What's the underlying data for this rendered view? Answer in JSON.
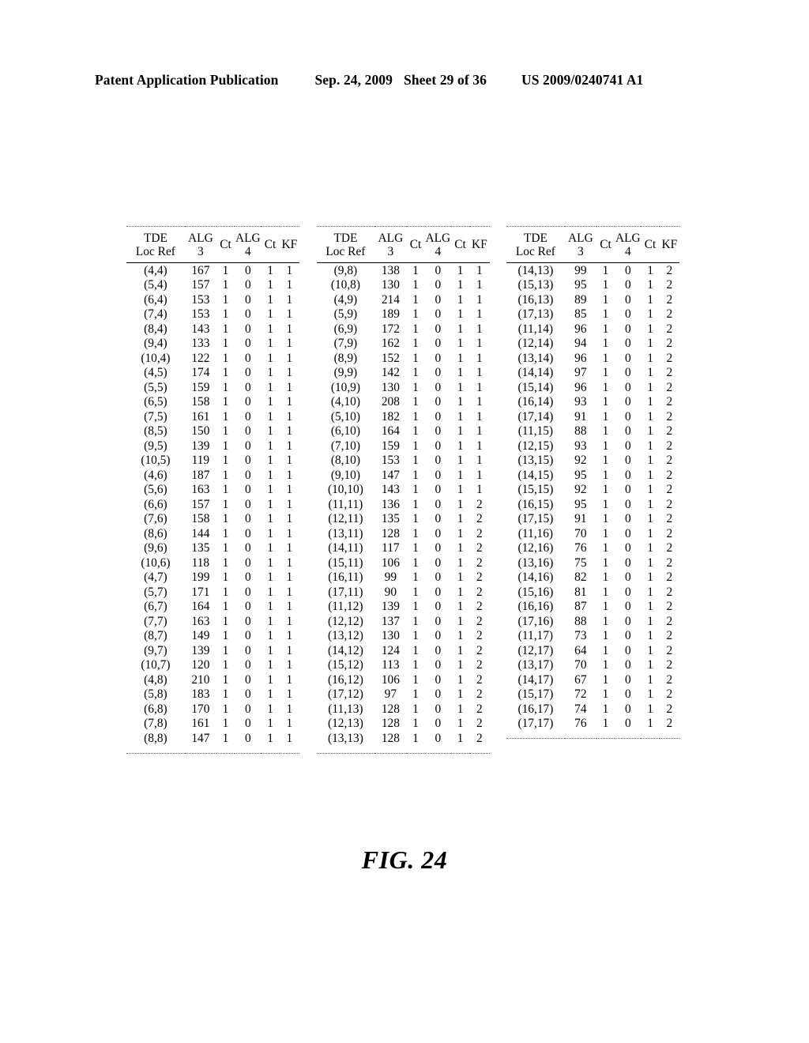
{
  "header": {
    "publication": "Patent Application Publication",
    "date": "Sep. 24, 2009",
    "sheet": "Sheet 29 of 36",
    "patent_number": "US 2009/0240741 A1"
  },
  "figure": {
    "caption": "FIG. 24"
  },
  "table": {
    "columns": [
      {
        "key": "loc",
        "label_line1": "TDE",
        "label_line2": "Loc Ref"
      },
      {
        "key": "alg3",
        "label_line1": "ALG",
        "label_line2": "3"
      },
      {
        "key": "ct1",
        "label_line1": "Ct",
        "label_line2": ""
      },
      {
        "key": "alg4",
        "label_line1": "ALG",
        "label_line2": "4"
      },
      {
        "key": "ct2",
        "label_line1": "Ct",
        "label_line2": ""
      },
      {
        "key": "kf",
        "label_line1": "KF",
        "label_line2": ""
      }
    ],
    "blocks": [
      {
        "id": "block-1",
        "rows": [
          [
            "(4,4)",
            "167",
            "1",
            "0",
            "1",
            "1"
          ],
          [
            "(5,4)",
            "157",
            "1",
            "0",
            "1",
            "1"
          ],
          [
            "(6,4)",
            "153",
            "1",
            "0",
            "1",
            "1"
          ],
          [
            "(7,4)",
            "153",
            "1",
            "0",
            "1",
            "1"
          ],
          [
            "(8,4)",
            "143",
            "1",
            "0",
            "1",
            "1"
          ],
          [
            "(9,4)",
            "133",
            "1",
            "0",
            "1",
            "1"
          ],
          [
            "(10,4)",
            "122",
            "1",
            "0",
            "1",
            "1"
          ],
          [
            "(4,5)",
            "174",
            "1",
            "0",
            "1",
            "1"
          ],
          [
            "(5,5)",
            "159",
            "1",
            "0",
            "1",
            "1"
          ],
          [
            "(6,5)",
            "158",
            "1",
            "0",
            "1",
            "1"
          ],
          [
            "(7,5)",
            "161",
            "1",
            "0",
            "1",
            "1"
          ],
          [
            "(8,5)",
            "150",
            "1",
            "0",
            "1",
            "1"
          ],
          [
            "(9,5)",
            "139",
            "1",
            "0",
            "1",
            "1"
          ],
          [
            "(10,5)",
            "119",
            "1",
            "0",
            "1",
            "1"
          ],
          [
            "(4,6)",
            "187",
            "1",
            "0",
            "1",
            "1"
          ],
          [
            "(5,6)",
            "163",
            "1",
            "0",
            "1",
            "1"
          ],
          [
            "(6,6)",
            "157",
            "1",
            "0",
            "1",
            "1"
          ],
          [
            "(7,6)",
            "158",
            "1",
            "0",
            "1",
            "1"
          ],
          [
            "(8,6)",
            "144",
            "1",
            "0",
            "1",
            "1"
          ],
          [
            "(9,6)",
            "135",
            "1",
            "0",
            "1",
            "1"
          ],
          [
            "(10,6)",
            "118",
            "1",
            "0",
            "1",
            "1"
          ],
          [
            "(4,7)",
            "199",
            "1",
            "0",
            "1",
            "1"
          ],
          [
            "(5,7)",
            "171",
            "1",
            "0",
            "1",
            "1"
          ],
          [
            "(6,7)",
            "164",
            "1",
            "0",
            "1",
            "1"
          ],
          [
            "(7,7)",
            "163",
            "1",
            "0",
            "1",
            "1"
          ],
          [
            "(8,7)",
            "149",
            "1",
            "0",
            "1",
            "1"
          ],
          [
            "(9,7)",
            "139",
            "1",
            "0",
            "1",
            "1"
          ],
          [
            "(10,7)",
            "120",
            "1",
            "0",
            "1",
            "1"
          ],
          [
            "(4,8)",
            "210",
            "1",
            "0",
            "1",
            "1"
          ],
          [
            "(5,8)",
            "183",
            "1",
            "0",
            "1",
            "1"
          ],
          [
            "(6,8)",
            "170",
            "1",
            "0",
            "1",
            "1"
          ],
          [
            "(7,8)",
            "161",
            "1",
            "0",
            "1",
            "1"
          ],
          [
            "(8,8)",
            "147",
            "1",
            "0",
            "1",
            "1"
          ]
        ]
      },
      {
        "id": "block-2",
        "rows": [
          [
            "(9,8)",
            "138",
            "1",
            "0",
            "1",
            "1"
          ],
          [
            "(10,8)",
            "130",
            "1",
            "0",
            "1",
            "1"
          ],
          [
            "(4,9)",
            "214",
            "1",
            "0",
            "1",
            "1"
          ],
          [
            "(5,9)",
            "189",
            "1",
            "0",
            "1",
            "1"
          ],
          [
            "(6,9)",
            "172",
            "1",
            "0",
            "1",
            "1"
          ],
          [
            "(7,9)",
            "162",
            "1",
            "0",
            "1",
            "1"
          ],
          [
            "(8,9)",
            "152",
            "1",
            "0",
            "1",
            "1"
          ],
          [
            "(9,9)",
            "142",
            "1",
            "0",
            "1",
            "1"
          ],
          [
            "(10,9)",
            "130",
            "1",
            "0",
            "1",
            "1"
          ],
          [
            "(4,10)",
            "208",
            "1",
            "0",
            "1",
            "1"
          ],
          [
            "(5,10)",
            "182",
            "1",
            "0",
            "1",
            "1"
          ],
          [
            "(6,10)",
            "164",
            "1",
            "0",
            "1",
            "1"
          ],
          [
            "(7,10)",
            "159",
            "1",
            "0",
            "1",
            "1"
          ],
          [
            "(8,10)",
            "153",
            "1",
            "0",
            "1",
            "1"
          ],
          [
            "(9,10)",
            "147",
            "1",
            "0",
            "1",
            "1"
          ],
          [
            "(10,10)",
            "143",
            "1",
            "0",
            "1",
            "1"
          ],
          [
            "(11,11)",
            "136",
            "1",
            "0",
            "1",
            "2"
          ],
          [
            "(12,11)",
            "135",
            "1",
            "0",
            "1",
            "2"
          ],
          [
            "(13,11)",
            "128",
            "1",
            "0",
            "1",
            "2"
          ],
          [
            "(14,11)",
            "117",
            "1",
            "0",
            "1",
            "2"
          ],
          [
            "(15,11)",
            "106",
            "1",
            "0",
            "1",
            "2"
          ],
          [
            "(16,11)",
            "99",
            "1",
            "0",
            "1",
            "2"
          ],
          [
            "(17,11)",
            "90",
            "1",
            "0",
            "1",
            "2"
          ],
          [
            "(11,12)",
            "139",
            "1",
            "0",
            "1",
            "2"
          ],
          [
            "(12,12)",
            "137",
            "1",
            "0",
            "1",
            "2"
          ],
          [
            "(13,12)",
            "130",
            "1",
            "0",
            "1",
            "2"
          ],
          [
            "(14,12)",
            "124",
            "1",
            "0",
            "1",
            "2"
          ],
          [
            "(15,12)",
            "113",
            "1",
            "0",
            "1",
            "2"
          ],
          [
            "(16,12)",
            "106",
            "1",
            "0",
            "1",
            "2"
          ],
          [
            "(17,12)",
            "97",
            "1",
            "0",
            "1",
            "2"
          ],
          [
            "(11,13)",
            "128",
            "1",
            "0",
            "1",
            "2"
          ],
          [
            "(12,13)",
            "128",
            "1",
            "0",
            "1",
            "2"
          ],
          [
            "(13,13)",
            "128",
            "1",
            "0",
            "1",
            "2"
          ]
        ]
      },
      {
        "id": "block-3",
        "rows": [
          [
            "(14,13)",
            "99",
            "1",
            "0",
            "1",
            "2"
          ],
          [
            "(15,13)",
            "95",
            "1",
            "0",
            "1",
            "2"
          ],
          [
            "(16,13)",
            "89",
            "1",
            "0",
            "1",
            "2"
          ],
          [
            "(17,13)",
            "85",
            "1",
            "0",
            "1",
            "2"
          ],
          [
            "(11,14)",
            "96",
            "1",
            "0",
            "1",
            "2"
          ],
          [
            "(12,14)",
            "94",
            "1",
            "0",
            "1",
            "2"
          ],
          [
            "(13,14)",
            "96",
            "1",
            "0",
            "1",
            "2"
          ],
          [
            "(14,14)",
            "97",
            "1",
            "0",
            "1",
            "2"
          ],
          [
            "(15,14)",
            "96",
            "1",
            "0",
            "1",
            "2"
          ],
          [
            "(16,14)",
            "93",
            "1",
            "0",
            "1",
            "2"
          ],
          [
            "(17,14)",
            "91",
            "1",
            "0",
            "1",
            "2"
          ],
          [
            "(11,15)",
            "88",
            "1",
            "0",
            "1",
            "2"
          ],
          [
            "(12,15)",
            "93",
            "1",
            "0",
            "1",
            "2"
          ],
          [
            "(13,15)",
            "92",
            "1",
            "0",
            "1",
            "2"
          ],
          [
            "(14,15)",
            "95",
            "1",
            "0",
            "1",
            "2"
          ],
          [
            "(15,15)",
            "92",
            "1",
            "0",
            "1",
            "2"
          ],
          [
            "(16,15)",
            "95",
            "1",
            "0",
            "1",
            "2"
          ],
          [
            "(17,15)",
            "91",
            "1",
            "0",
            "1",
            "2"
          ],
          [
            "(11,16)",
            "70",
            "1",
            "0",
            "1",
            "2"
          ],
          [
            "(12,16)",
            "76",
            "1",
            "0",
            "1",
            "2"
          ],
          [
            "(13,16)",
            "75",
            "1",
            "0",
            "1",
            "2"
          ],
          [
            "(14,16)",
            "82",
            "1",
            "0",
            "1",
            "2"
          ],
          [
            "(15,16)",
            "81",
            "1",
            "0",
            "1",
            "2"
          ],
          [
            "(16,16)",
            "87",
            "1",
            "0",
            "1",
            "2"
          ],
          [
            "(17,16)",
            "88",
            "1",
            "0",
            "1",
            "2"
          ],
          [
            "(11,17)",
            "73",
            "1",
            "0",
            "1",
            "2"
          ],
          [
            "(12,17)",
            "64",
            "1",
            "0",
            "1",
            "2"
          ],
          [
            "(13,17)",
            "70",
            "1",
            "0",
            "1",
            "2"
          ],
          [
            "(14,17)",
            "67",
            "1",
            "0",
            "1",
            "2"
          ],
          [
            "(15,17)",
            "72",
            "1",
            "0",
            "1",
            "2"
          ],
          [
            "(16,17)",
            "74",
            "1",
            "0",
            "1",
            "2"
          ],
          [
            "(17,17)",
            "76",
            "1",
            "0",
            "1",
            "2"
          ]
        ]
      }
    ]
  }
}
